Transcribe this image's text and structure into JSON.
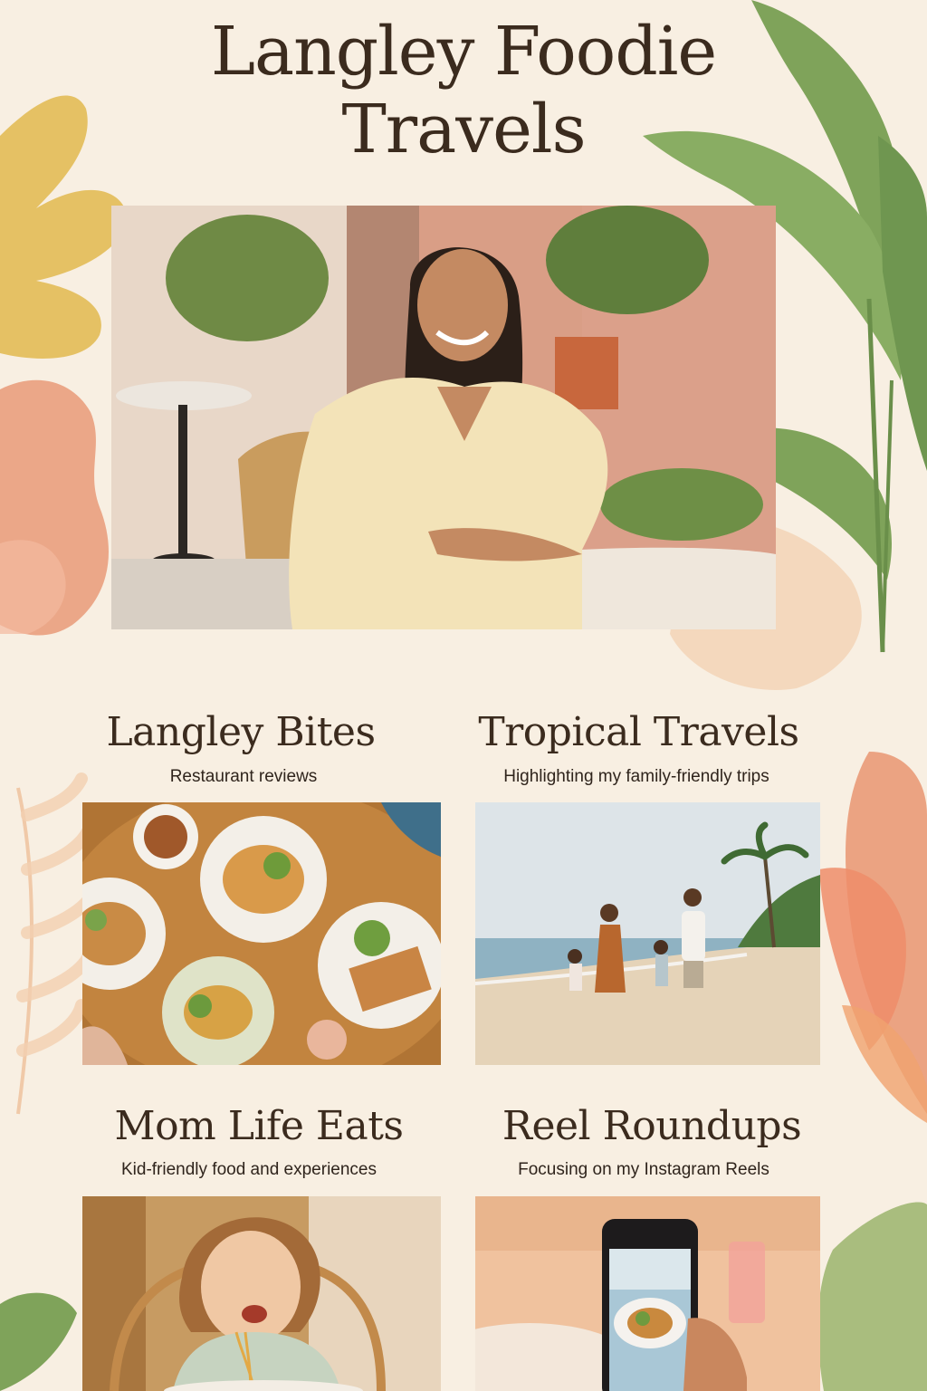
{
  "page": {
    "title_line1": "Langley Foodie",
    "title_line2": "Travels"
  },
  "sections": [
    {
      "title": "Langley Bites",
      "subtitle": "Restaurant reviews"
    },
    {
      "title": "Tropical Travels",
      "subtitle": "Highlighting my family-friendly trips"
    },
    {
      "title": "Mom Life Eats",
      "subtitle": "Kid-friendly food and experiences"
    },
    {
      "title": "Reel Roundups",
      "subtitle": "Focusing on my Instagram Reels"
    }
  ],
  "colors": {
    "background": "#f8efe2",
    "text": "#3b2b1e",
    "accent_mustard": "#e2b94d",
    "accent_coral": "#e99a78",
    "leaf_green": "#7fa35a"
  }
}
